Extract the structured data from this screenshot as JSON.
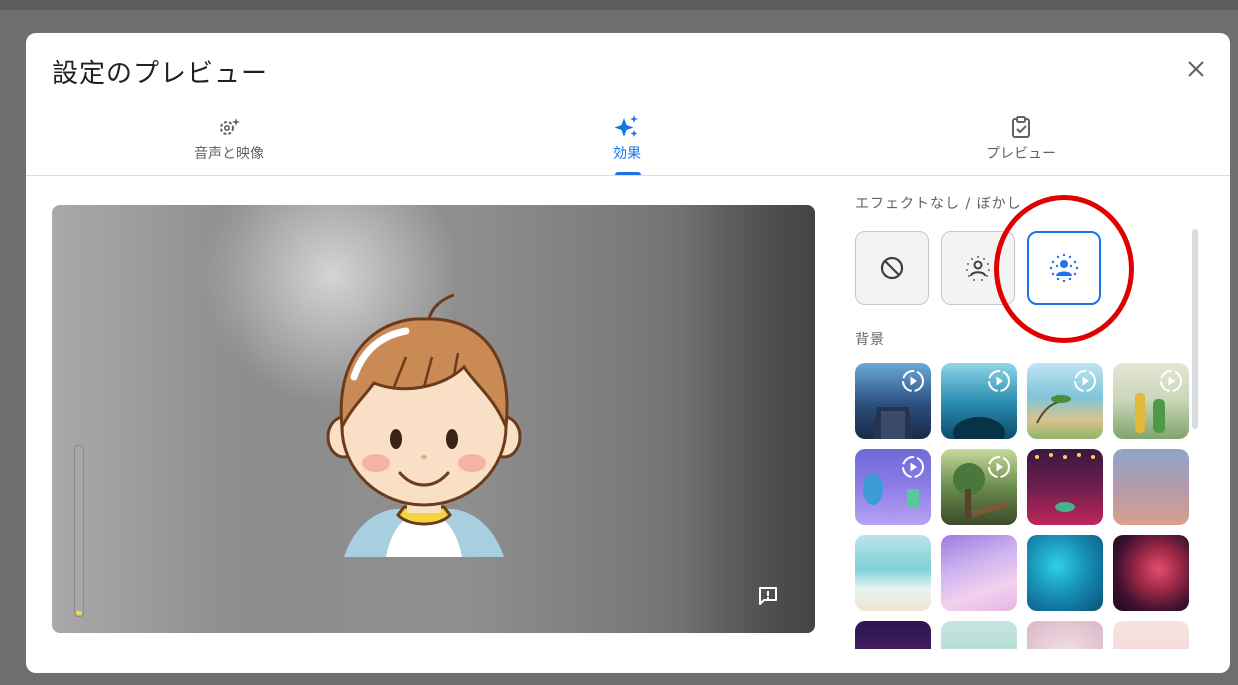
{
  "dialog": {
    "title": "設定のプレビュー",
    "close_icon": "close-icon"
  },
  "tabs": [
    {
      "label": "音声と映像",
      "icon": "gear-sparkle-icon",
      "active": false
    },
    {
      "label": "効果",
      "icon": "sparkle-icon",
      "active": true
    },
    {
      "label": "プレビュー",
      "icon": "clipboard-check-icon",
      "active": false
    }
  ],
  "video": {
    "level_meter_fraction": 0.02,
    "feedback_icon": "feedback-icon"
  },
  "effects": {
    "section_label": "エフェクトなし / ぼかし",
    "options": [
      {
        "icon": "no-effect-icon",
        "selected": false
      },
      {
        "icon": "slight-blur-icon",
        "selected": false
      },
      {
        "icon": "blur-icon",
        "selected": true
      }
    ]
  },
  "backgrounds": {
    "section_label": "背景"
  },
  "colors": {
    "accent": "#1a73e8",
    "highlight_ring": "#e00000"
  }
}
